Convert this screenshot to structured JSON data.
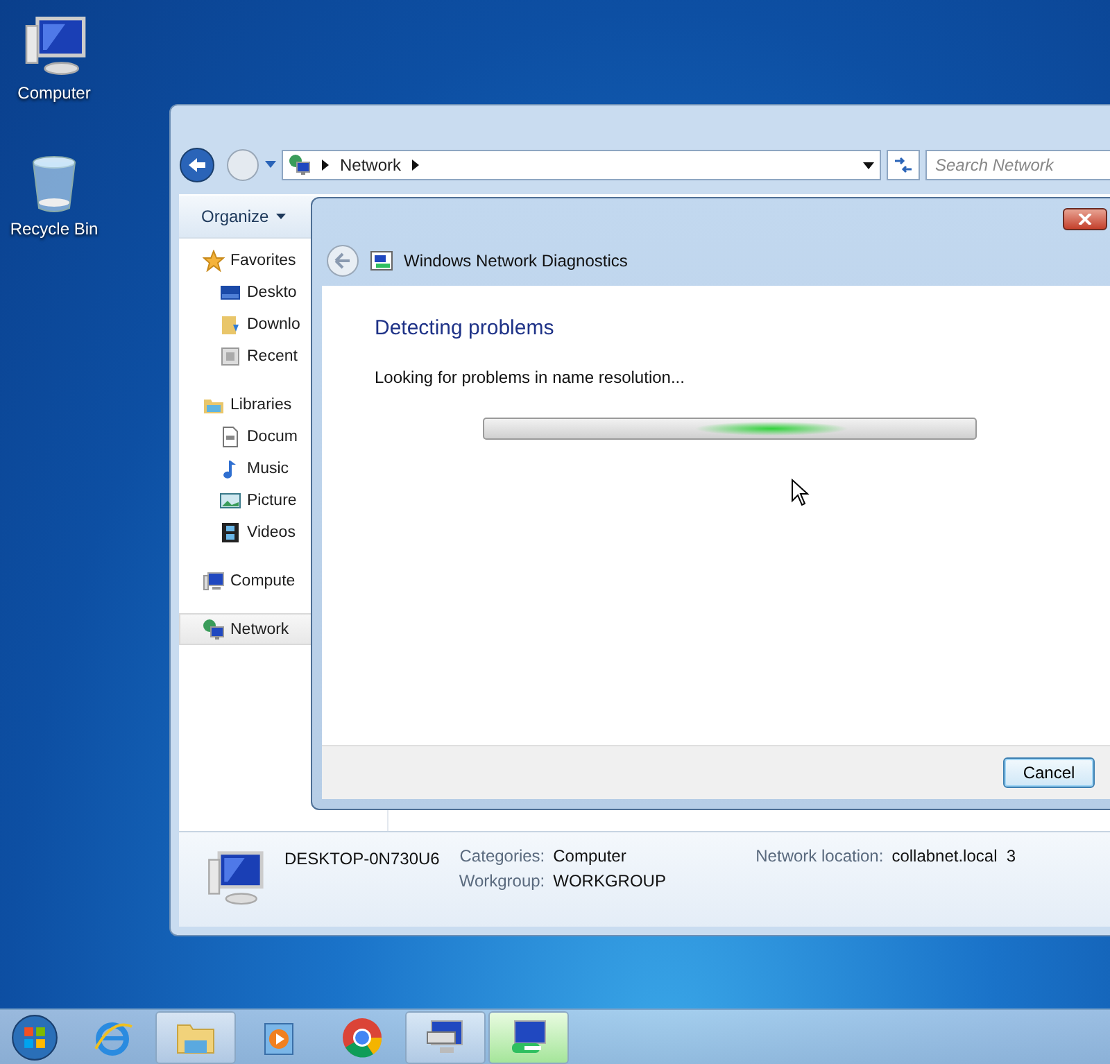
{
  "desktop_icons": [
    {
      "label": "Computer"
    },
    {
      "label": "Recycle Bin"
    }
  ],
  "explorer": {
    "address": {
      "segments": [
        "Network"
      ]
    },
    "search": {
      "placeholder": "Search Network"
    },
    "toolbar": {
      "organize": "Organize"
    },
    "sidebar": {
      "groups": [
        {
          "label": "Favorites",
          "selected": false,
          "children": [
            {
              "label": "Deskto",
              "selected": false
            },
            {
              "label": "Downlo",
              "selected": false
            },
            {
              "label": "Recent",
              "selected": false
            }
          ]
        },
        {
          "label": "Libraries",
          "selected": false,
          "children": [
            {
              "label": "Docum",
              "selected": false
            },
            {
              "label": "Music",
              "selected": false
            },
            {
              "label": "Picture",
              "selected": false
            },
            {
              "label": "Videos",
              "selected": false
            }
          ]
        },
        {
          "label": "Compute",
          "selected": false
        },
        {
          "label": "Network",
          "selected": true
        }
      ]
    },
    "details": {
      "name": "DESKTOP-0N730U6",
      "fields": [
        {
          "label": "Categories:",
          "value": "Computer"
        },
        {
          "label": "Workgroup:",
          "value": "WORKGROUP"
        },
        {
          "label": "Network location:",
          "value": "collabnet.local  3"
        }
      ]
    }
  },
  "dialog": {
    "title": "Windows Network Diagnostics",
    "heading": "Detecting problems",
    "status": "Looking for problems in name resolution...",
    "buttons": [
      "Cancel"
    ]
  },
  "taskbar": {
    "items": [
      {
        "running": false,
        "selected": false
      },
      {
        "running": true,
        "selected": false
      },
      {
        "running": false,
        "selected": false
      },
      {
        "running": false,
        "selected": false
      },
      {
        "running": true,
        "selected": false
      },
      {
        "running": true,
        "selected": true
      }
    ]
  }
}
